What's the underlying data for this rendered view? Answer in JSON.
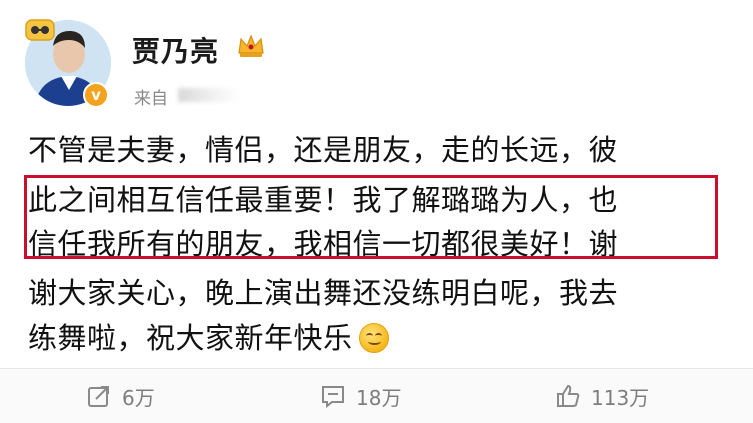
{
  "header": {
    "username": "贾乃亮",
    "source_text": "来自",
    "avatar_badge": "vip-crown-icon",
    "verified_badge": "v"
  },
  "content": {
    "lines": [
      "不管是夫妻，情侣，还是朋友，走的长远，彼",
      "此之间相互信任最重要！我了解璐璐为人，也",
      "信任我所有的朋友，我相信一切都很美好！谢",
      "谢大家关心，晚上演出舞还没练明白呢，我去",
      "练舞啦，祝大家新年快乐"
    ],
    "emoji": "smile-emoji",
    "highlight_color": "#c8102e"
  },
  "footer": {
    "repost_count": "6万",
    "comment_count": "18万",
    "like_count": "113万"
  },
  "colors": {
    "text": "#111111",
    "muted": "#8a8a8a",
    "footer_text": "#7d7d7d",
    "badge": "#f4a11c"
  }
}
